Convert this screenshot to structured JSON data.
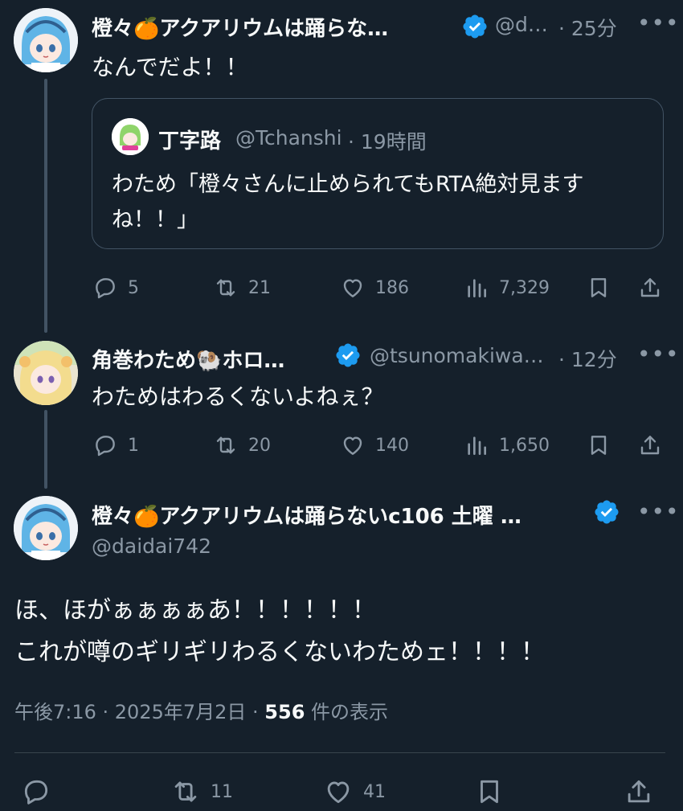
{
  "tweet1": {
    "name": "橙々🍊アクアリウムは踊らな…",
    "handle": "@d…",
    "time": "· 25分",
    "text": "なんでだよ！！",
    "quote": {
      "name": "丁字路",
      "handle": "@Tchanshi",
      "time": "· 19時間",
      "text_line1": "わため「橙々さんに止められてもRTA絶対見ます",
      "text_line2": "ね！！」"
    },
    "actions": {
      "reply": "5",
      "retweet": "21",
      "like": "186",
      "views": "7,329"
    }
  },
  "tweet2": {
    "name": "角巻わため🐏ホロ…",
    "handle": "@tsunomakiwa…",
    "time": "· 12分",
    "text": "わためはわるくないよねぇ？",
    "actions": {
      "reply": "1",
      "retweet": "20",
      "like": "140",
      "views": "1,650"
    }
  },
  "main": {
    "name": "橙々🍊アクアリウムは踊らないc106 土曜 …",
    "handle": "@daidai742",
    "text_line1": "ほ、ほがぁぁぁぁあ！！！！！！",
    "text_line2": "これが噂のギリギリわるくないわためェ！！！！",
    "meta_time": "午後7:16 · 2025年7月2日 · ",
    "views_count": "556",
    "views_label": " 件の表示",
    "actions": {
      "retweet": "11",
      "like": "41"
    }
  },
  "colors": {
    "background": "#15202b",
    "text": "#f7f9f9",
    "muted": "#8b98a5",
    "verified": "#1d9bf0",
    "border": "#425364"
  },
  "icons": [
    "more-icon",
    "verified-badge-icon",
    "reply-icon",
    "retweet-icon",
    "like-icon",
    "views-icon",
    "bookmark-icon",
    "share-icon"
  ]
}
